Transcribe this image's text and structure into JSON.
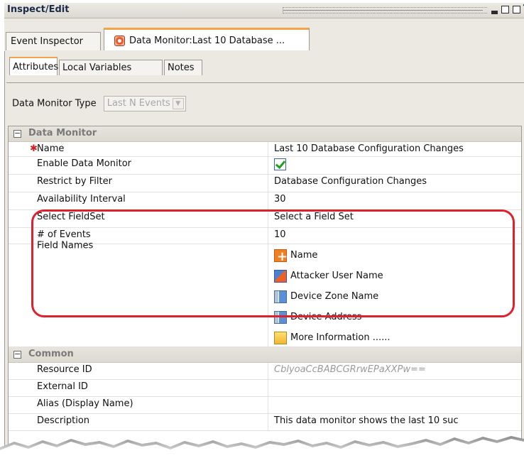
{
  "window": {
    "title": "Inspect/Edit",
    "help_glyph": "?"
  },
  "tabs": [
    {
      "label": "Event Inspector"
    },
    {
      "label": "Data Monitor:Last 10 Database ..."
    }
  ],
  "subtabs": [
    {
      "label": "Attributes"
    },
    {
      "label": "Local Variables"
    },
    {
      "label": "Notes"
    }
  ],
  "monitor_type": {
    "label": "Data Monitor Type",
    "value": "Last N Events"
  },
  "sections": {
    "data_monitor": {
      "title": "Data Monitor",
      "toggle": "⊟"
    },
    "common": {
      "title": "Common",
      "toggle": "⊟"
    }
  },
  "rows": {
    "name": {
      "label": "Name",
      "value": "Last 10 Database Configuration Changes",
      "required_mark": "✱"
    },
    "enable": {
      "label": "Enable Data Monitor",
      "checked": true
    },
    "filter": {
      "label": "Restrict by Filter",
      "value": "Database Configuration Changes"
    },
    "interval": {
      "label": "Availability Interval",
      "value": "30"
    },
    "fieldset": {
      "label": "Select FieldSet",
      "value": "Select a Field Set"
    },
    "events": {
      "label": "# of Events",
      "value": "10"
    },
    "field_names": {
      "label": "Field Names",
      "items": [
        {
          "label": "Name",
          "icon": "name-field-icon"
        },
        {
          "label": "Attacker User Name",
          "icon": "attacker-user-icon"
        },
        {
          "label": "Device Zone Name",
          "icon": "device-icon"
        },
        {
          "label": "Device Address",
          "icon": "device-icon"
        },
        {
          "label": "More Information ......",
          "icon": "more-info-icon"
        }
      ]
    },
    "resource_id": {
      "label": "Resource ID",
      "value": "CblyoaCcBABCGRrwEPaXXPw=="
    },
    "external_id": {
      "label": "External ID",
      "value": ""
    },
    "alias": {
      "label": "Alias (Display Name)",
      "value": ""
    },
    "description": {
      "label": "Description",
      "value": "This data monitor shows the last 10 suc"
    }
  },
  "colors": {
    "highlight": "#e0202c",
    "active_tab_accent": "#f1a44a",
    "checkmark": "#21a020"
  }
}
